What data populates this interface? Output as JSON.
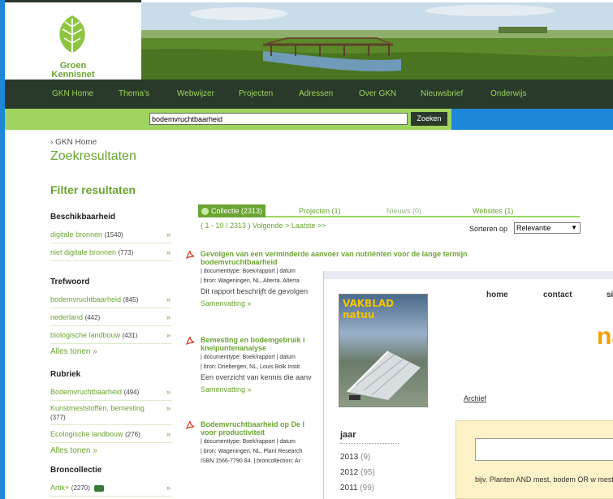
{
  "logo": {
    "line1": "Groen",
    "line2": "Kennisnet"
  },
  "nav": [
    {
      "label": "GKN Home"
    },
    {
      "label": "Thema's"
    },
    {
      "label": "Webwijzer"
    },
    {
      "label": "Projecten"
    },
    {
      "label": "Adressen"
    },
    {
      "label": "Over GKN"
    },
    {
      "label": "Nieuwsbrief"
    },
    {
      "label": "Onderwijs"
    }
  ],
  "search": {
    "value": "bodemvruchtbaarheid",
    "button": "Zoeken"
  },
  "breadcrumb": "› GKN Home",
  "page_title": "Zoekresultaten",
  "filter_title": "Filter resultaten",
  "sidebar": {
    "availability": {
      "heading": "Beschikbaarheid",
      "items": [
        {
          "label": "digitale bronnen",
          "count": "(1540)"
        },
        {
          "label": "niet digitale bronnen",
          "count": "(773)"
        }
      ]
    },
    "keyword": {
      "heading": "Trefwoord",
      "items": [
        {
          "label": "bodemvruchtbaarheid",
          "count": "(845)"
        },
        {
          "label": "nederland",
          "count": "(442)"
        },
        {
          "label": "biologische landbouw",
          "count": "(431)"
        }
      ],
      "show_all": "Alles tonen  »"
    },
    "rubric": {
      "heading": "Rubriek",
      "items": [
        {
          "label": "Bodemvruchtbaarheid",
          "count": "(494)"
        },
        {
          "label": "Kunstmeststoffen, bemesting",
          "count": "(377)"
        },
        {
          "label": "Ecologische landbouw",
          "count": "(276)"
        }
      ],
      "show_all": "Alles tonen  »"
    },
    "collection": {
      "heading": "Broncollectie",
      "items": [
        {
          "label": "Artik+",
          "count": "(2270)"
        }
      ]
    },
    "arrow": "»"
  },
  "tabs": [
    {
      "label": "Collectie (2313)"
    },
    {
      "label": "Projecten (1)"
    },
    {
      "label": "Nieuws (0)"
    },
    {
      "label": "Websites (1)"
    }
  ],
  "pager": "( 1 - 10 / 2313 ) Volgende > Laatste >>",
  "sort": {
    "label": "Sorteren op",
    "value": "Relevantie"
  },
  "results": [
    {
      "title": "Gevolgen van een verminderde aanvoer van nutriënten voor de lange termijn bodemvruchtbaarheid",
      "meta1": "| documenttype: Boek/rapport | datum",
      "meta2": "| bron: Wageningen, NL, Alterra. Alterra",
      "desc": "Dit rapport beschrijft de gevolgen",
      "summary": "Samenvatting  »"
    },
    {
      "title": "Bemesting en bodemgebruik i knelpuntenanalyse",
      "meta1": "| documenttype: Boek/rapport | datum",
      "meta2": "| bron: Driebergen, NL, Louis Bolk Instit",
      "desc": "Een overzicht van kennis die aanv",
      "summary": "Samenvatting  »"
    },
    {
      "title": "Bodemvruchtbaarheid op De I voor productiviteit",
      "meta1": "| documenttype: Boek/rapport | datum",
      "meta2": "| bron: Wageningen, NL, Plant Research",
      "meta3": "ISBN 1566-7790 84. | broncollection: Ar",
      "desc": "",
      "summary": ""
    }
  ],
  "overlay": {
    "nav": [
      {
        "label": "home"
      },
      {
        "label": "contact"
      },
      {
        "label": "si"
      }
    ],
    "magazine_title": "VAKBLAD natuu",
    "big_letter": "na",
    "archief": "Archief",
    "jaar": "jaar",
    "years": [
      {
        "label": "2013",
        "count": "(9)"
      },
      {
        "label": "2012",
        "count": "(95)"
      },
      {
        "label": "2011",
        "count": "(99)"
      }
    ],
    "hint": "bijv. Planten AND mest, bodem OR w mest"
  }
}
